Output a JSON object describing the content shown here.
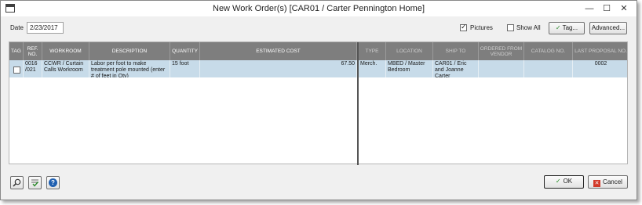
{
  "window": {
    "title": "New Work Order(s) [CAR01 / Carter Pennington Home]",
    "minimize_glyph": "—",
    "maximize_glyph": "☐",
    "close_glyph": "✕"
  },
  "form": {
    "date_label": "Date",
    "date_value": "2/23/2017",
    "pictures_label": "Pictures",
    "pictures_checked": true,
    "show_all_label": "Show All",
    "show_all_checked": false,
    "tag_button_label": "Tag...",
    "advanced_button_label": "Advanced..."
  },
  "grid": {
    "columns": [
      "Tag",
      "Ref. No.",
      "Workroom",
      "Description",
      "Quantity",
      "Estimated Cost",
      "Type",
      "Location",
      "Ship To",
      "Ordered From Vendor",
      "Catalog No.",
      "Last Proposal No."
    ],
    "rows": [
      {
        "tag": "",
        "ref_no": "0016 /021",
        "workroom": "CCWR / Curtain Calls Workroom",
        "description": "Labor per foot to make treatment pole mounted (enter # of feet in Qty)",
        "quantity": "15 foot",
        "estimated_cost": "67.50",
        "type": "Merch.",
        "location": "MBED / Master Bedroom",
        "ship_to": "CAR01 / Eric and Joanne Carter",
        "ordered_from_vendor": "",
        "catalog_no": "",
        "last_proposal_no": "0002"
      }
    ]
  },
  "footer": {
    "search_icon": "magnifier-icon",
    "check_icon": "checklist-icon",
    "help_icon": "help-icon",
    "help_glyph": "?",
    "ok_label": "OK",
    "cancel_label": "Cancel"
  },
  "colors": {
    "header_bg": "#7e7e7e",
    "row_selected_bg": "#c7dbe9",
    "ok_check": "#1f8a1f",
    "cancel_x": "#d23a2a",
    "help_blue": "#1f5fb0"
  }
}
